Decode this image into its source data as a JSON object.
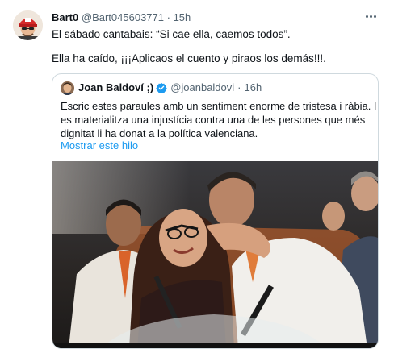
{
  "tweet": {
    "author_name": "Bart0",
    "author_handle": "@Bart045603771",
    "separator": "·",
    "time": "15h",
    "lines": [
      "El sábado cantabais: “Si cae ella, caemos todos”.",
      "Ella ha caído, ¡¡¡Aplicaos el cuento y piraos los demás!!!."
    ]
  },
  "quoted": {
    "author_name": "Joan Baldoví ;)",
    "author_handle": "@joanbaldovi",
    "separator": "·",
    "time": "16h",
    "lines": [
      "Escric estes paraules amb un sentiment enorme de tristesa i ràbia. Hui",
      "es materialitza una injustícia contra una de les persones que més",
      "dignitat li ha donat a la política valenciana."
    ],
    "show_thread": "Mostrar este hilo"
  },
  "colors": {
    "link": "#1d9bf0",
    "muted": "#536471",
    "verified": "#1d9bf0",
    "border": "#cfd9de"
  },
  "icons": {
    "more": "more-horizontal-icon",
    "verified": "verified-badge-icon"
  }
}
